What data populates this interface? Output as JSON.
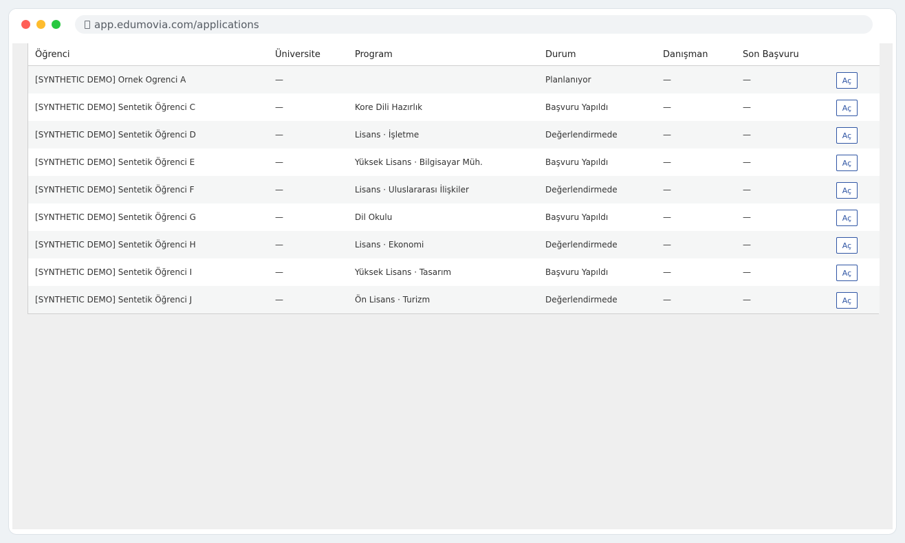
{
  "browser": {
    "url": "app.edumovia.com/applications"
  },
  "table": {
    "headers": [
      "Öğrenci",
      "Üniversite",
      "Program",
      "Durum",
      "Danışman",
      "Son Başvuru",
      ""
    ],
    "open_label": "Aç",
    "rows": [
      {
        "student": "[SYNTHETIC DEMO] Ornek Ogrenci A",
        "university": "—",
        "program": "",
        "status": "Planlanıyor",
        "advisor": "—",
        "deadline": "—"
      },
      {
        "student": "[SYNTHETIC DEMO] Sentetik Öğrenci C",
        "university": "—",
        "program": "Kore Dili Hazırlık",
        "status": "Başvuru Yapıldı",
        "advisor": "—",
        "deadline": "—"
      },
      {
        "student": "[SYNTHETIC DEMO] Sentetik Öğrenci D",
        "university": "—",
        "program": "Lisans · İşletme",
        "status": "Değerlendirmede",
        "advisor": "—",
        "deadline": "—"
      },
      {
        "student": "[SYNTHETIC DEMO] Sentetik Öğrenci E",
        "university": "—",
        "program": "Yüksek Lisans · Bilgisayar Müh.",
        "status": "Başvuru Yapıldı",
        "advisor": "—",
        "deadline": "—"
      },
      {
        "student": "[SYNTHETIC DEMO] Sentetik Öğrenci F",
        "university": "—",
        "program": "Lisans · Uluslararası İlişkiler",
        "status": "Değerlendirmede",
        "advisor": "—",
        "deadline": "—"
      },
      {
        "student": "[SYNTHETIC DEMO] Sentetik Öğrenci G",
        "university": "—",
        "program": "Dil Okulu",
        "status": "Başvuru Yapıldı",
        "advisor": "—",
        "deadline": "—"
      },
      {
        "student": "[SYNTHETIC DEMO] Sentetik Öğrenci H",
        "university": "—",
        "program": "Lisans · Ekonomi",
        "status": "Değerlendirmede",
        "advisor": "—",
        "deadline": "—"
      },
      {
        "student": "[SYNTHETIC DEMO] Sentetik Öğrenci I",
        "university": "—",
        "program": "Yüksek Lisans · Tasarım",
        "status": "Başvuru Yapıldı",
        "advisor": "—",
        "deadline": "—"
      },
      {
        "student": "[SYNTHETIC DEMO] Sentetik Öğrenci J",
        "university": "—",
        "program": "Ön Lisans · Turizm",
        "status": "Değerlendirmede",
        "advisor": "—",
        "deadline": "—"
      }
    ]
  }
}
